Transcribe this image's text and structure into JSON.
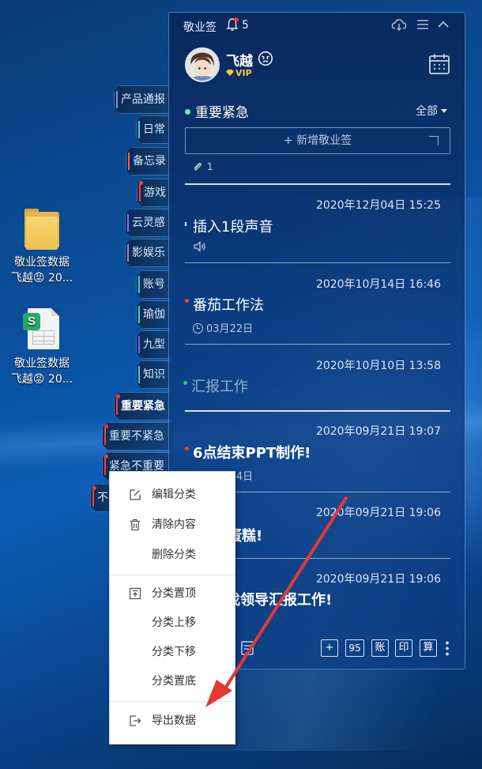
{
  "desktop": {
    "icons": [
      {
        "name": "folder",
        "line1": "敬业签数据",
        "line2": "飞越😡 20..."
      },
      {
        "name": "spreadsheet",
        "line1": "敬业签数据",
        "line2": "飞越😡 20..."
      }
    ]
  },
  "categories": [
    {
      "label": "产品通报",
      "accent": "#7b8bff"
    },
    {
      "label": "日常",
      "accent": "#3fd0d8"
    },
    {
      "label": "备忘录",
      "accent": "#ff5a5a"
    },
    {
      "label": "游戏",
      "accent": "#ff3b30"
    },
    {
      "label": "云灵感",
      "accent": "#8a6bff"
    },
    {
      "label": "影娱乐",
      "accent": "#9b8bd0"
    },
    {
      "label": "账号",
      "accent": "#3fd0d8"
    },
    {
      "label": "瑜伽",
      "accent": "#3fd0d8"
    },
    {
      "label": "九型",
      "accent": "#7b5bff"
    },
    {
      "label": "知识",
      "accent": "#3fd0d8"
    },
    {
      "label": "重要紧急",
      "accent": "#ff3b30"
    },
    {
      "label": "重要不紧急",
      "accent": "#ff3b30"
    },
    {
      "label": "紧急不重要",
      "accent": "#ff3b30"
    },
    {
      "label": "不",
      "accent": "#ff3b30"
    }
  ],
  "panel": {
    "app_title": "敬业签",
    "notification_count": "5",
    "user": {
      "name": "飞越",
      "vip": "VIP"
    },
    "category_title": "重要紧急",
    "filter": "全部",
    "new_note_placeholder": "+ 新增敬业签",
    "attachment_count": "1",
    "notes": [
      {
        "date": "2020年12月04日 15:25",
        "title": "插入1段声音",
        "meta": "",
        "dot": "#ffffff"
      },
      {
        "date": "2020年10月14日 16:46",
        "title": "番茄工作法",
        "meta": "03月22日",
        "dot": "#ff3b30"
      },
      {
        "date": "2020年10月10日 13:58",
        "title": "汇报工作",
        "meta": "",
        "dot": "#2ecc71"
      },
      {
        "date": "2020年09月21日 19:07",
        "title": "6点结束PPT制作!",
        "meta": "03月24日",
        "dot": "#ff3b30"
      },
      {
        "date": "2020年09月21日 19:06",
        "title": "蛋糕!",
        "meta": "",
        "dot": ""
      },
      {
        "date": "2020年09月21日 19:06",
        "title": "找领导汇报工作!",
        "meta": "",
        "dot": ""
      }
    ],
    "bottom": {
      "plus": "+",
      "count": "95",
      "ledger": "账",
      "print": "印",
      "calc": "算"
    }
  },
  "context_menu": {
    "items": [
      "编辑分类",
      "清除内容",
      "删除分类",
      "分类置顶",
      "分类上移",
      "分类下移",
      "分类置底",
      "导出数据"
    ]
  },
  "colors": {
    "arrow": "#e53935",
    "accent_dot": "#6fe3c7"
  }
}
